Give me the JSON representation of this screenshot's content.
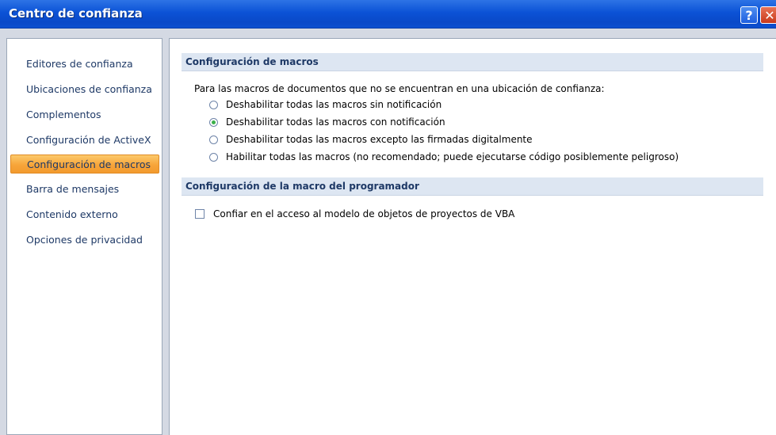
{
  "window": {
    "title": "Centro de confianza",
    "help_glyph": "?",
    "close_glyph": "✕"
  },
  "sidebar": {
    "items": [
      {
        "label": "Editores de confianza",
        "selected": false
      },
      {
        "label": "Ubicaciones de confianza",
        "selected": false
      },
      {
        "label": "Complementos",
        "selected": false
      },
      {
        "label": "Configuración de ActiveX",
        "selected": false
      },
      {
        "label": "Configuración de macros",
        "selected": true
      },
      {
        "label": "Barra de mensajes",
        "selected": false
      },
      {
        "label": "Contenido externo",
        "selected": false
      },
      {
        "label": "Opciones de privacidad",
        "selected": false
      }
    ]
  },
  "macros": {
    "header": "Configuración de macros",
    "description": "Para las macros de documentos que no se encuentran en una ubicación de confianza:",
    "options": [
      {
        "label": "Deshabilitar todas las macros sin notificación",
        "checked": false
      },
      {
        "label": "Deshabilitar todas las macros con notificación",
        "checked": true
      },
      {
        "label": "Deshabilitar todas las macros excepto las firmadas digitalmente",
        "checked": false
      },
      {
        "label": "Habilitar todas las macros (no recomendado; puede ejecutarse código posiblemente peligroso)",
        "checked": false
      }
    ]
  },
  "developer": {
    "header": "Configuración de la macro del programador",
    "checkbox_label": "Confiar en el acceso al modelo de objetos de proyectos de VBA",
    "checked": false
  }
}
